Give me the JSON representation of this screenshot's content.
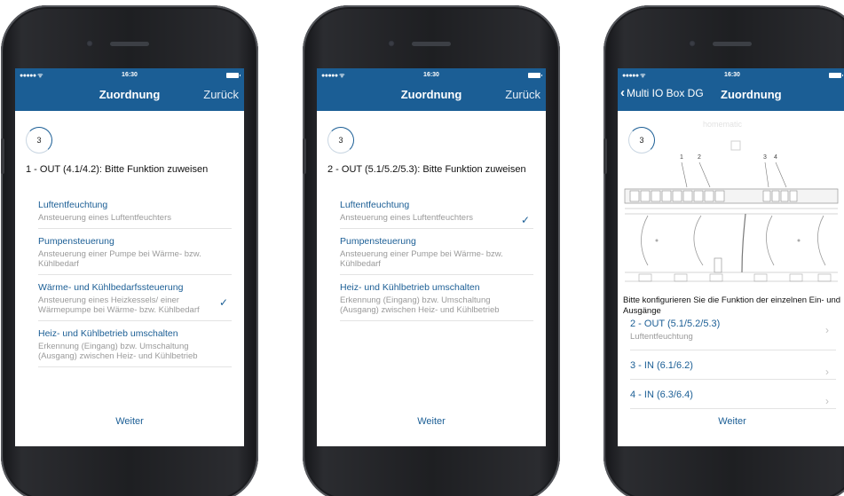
{
  "status": {
    "signal": "●●●●● ᯤ",
    "time": "16:30"
  },
  "phone1": {
    "nav_title": "Zuordnung",
    "nav_back": "Zurück",
    "step": "3",
    "heading": "1 - OUT (4.1/4.2): Bitte Funktion zuweisen",
    "options": [
      {
        "title": "Luftentfeuchtung",
        "desc": "Ansteuerung eines Luftentfeuchters"
      },
      {
        "title": "Pumpensteuerung",
        "desc": "Ansteuerung einer Pumpe bei Wärme- bzw. Kühlbedarf"
      },
      {
        "title": "Wärme- und Kühlbedarfssteuerung",
        "desc": "Ansteuerung eines Heizkessels/ einer Wärmepumpe bei Wärme- bzw. Kühlbedarf",
        "checked": "✓"
      },
      {
        "title": "Heiz- und Kühlbetrieb umschalten",
        "desc": "Erkennung (Eingang) bzw. Umschaltung (Ausgang) zwischen Heiz- und Kühlbetrieb"
      }
    ],
    "next": "Weiter"
  },
  "phone2": {
    "nav_title": "Zuordnung",
    "nav_back": "Zurück",
    "step": "3",
    "heading": "2 - OUT (5.1/5.2/5.3): Bitte Funktion zuweisen",
    "options": [
      {
        "title": "Luftentfeuchtung",
        "desc": "Ansteuerung eines Luftentfeuchters",
        "checked": "✓"
      },
      {
        "title": "Pumpensteuerung",
        "desc": "Ansteuerung einer Pumpe bei Wärme- bzw. Kühlbedarf"
      },
      {
        "title": "Heiz- und Kühlbetrieb umschalten",
        "desc": "Erkennung (Eingang) bzw. Umschaltung (Ausgang) zwischen Heiz- und Kühlbetrieb"
      }
    ],
    "next": "Weiter"
  },
  "phone3": {
    "nav_back": "Multi IO Box DG",
    "nav_title": "Zuordnung",
    "step": "3",
    "brand": "homematic",
    "callouts": [
      "1",
      "2",
      "3",
      "4"
    ],
    "config_text": "Bitte konfigurieren Sie die Funktion der einzelnen Ein- und Ausgänge",
    "io_rows": [
      {
        "title": "2 - OUT (5.1/5.2/5.3)",
        "sub": "Luftentfeuchtung"
      },
      {
        "title": "3 - IN (6.1/6.2)",
        "sub": ""
      },
      {
        "title": "4 - IN (6.3/6.4)",
        "sub": ""
      }
    ],
    "next": "Weiter"
  },
  "colors": {
    "accent": "#1b5e95",
    "muted": "#9a9a9a",
    "divider": "#e3e3e3"
  }
}
